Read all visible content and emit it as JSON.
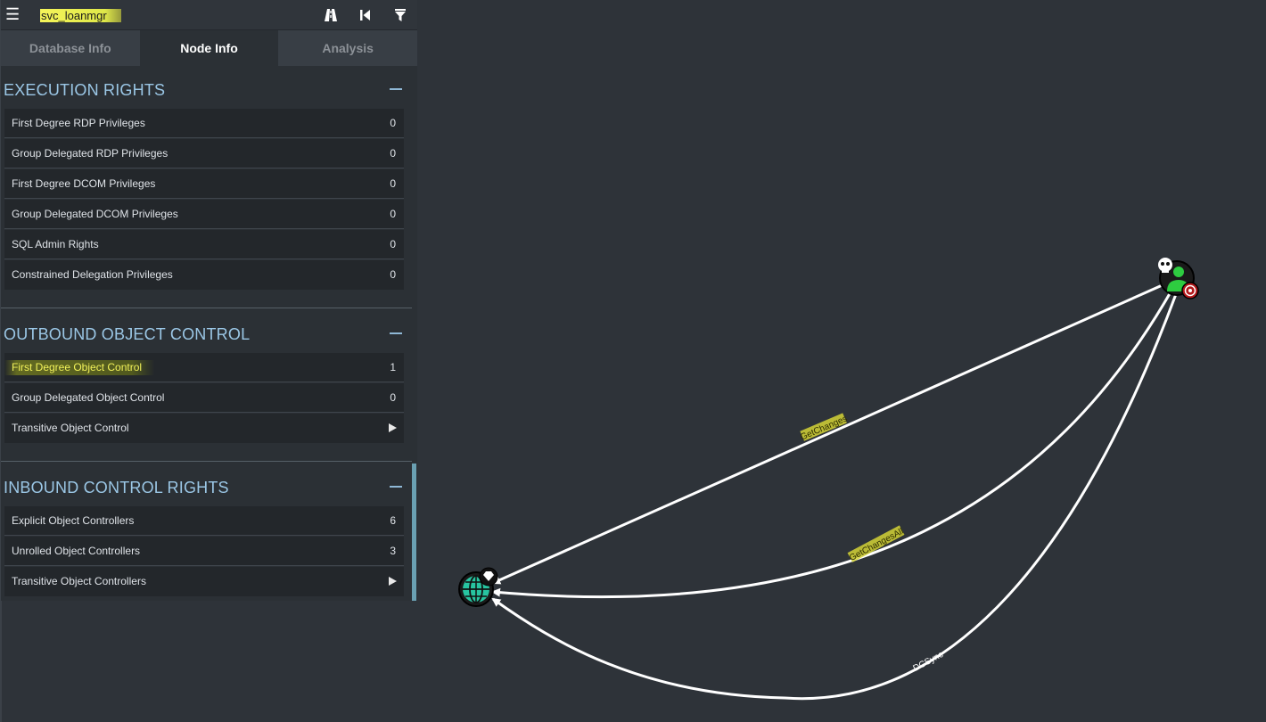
{
  "search": {
    "value": "svc_loanmgr"
  },
  "toolbar": {
    "pathfinding_icon": "road-icon",
    "back_icon": "skip-back-icon",
    "filter_icon": "filter-icon"
  },
  "tabs": [
    {
      "label": "Database Info",
      "active": false
    },
    {
      "label": "Node Info",
      "active": true
    },
    {
      "label": "Analysis",
      "active": false
    }
  ],
  "sections": {
    "execution": {
      "title": "EXECUTION RIGHTS",
      "rows": [
        {
          "label": "First Degree RDP Privileges",
          "value": "0"
        },
        {
          "label": "Group Delegated RDP Privileges",
          "value": "0"
        },
        {
          "label": "First Degree DCOM Privileges",
          "value": "0"
        },
        {
          "label": "Group Delegated DCOM Privileges",
          "value": "0"
        },
        {
          "label": "SQL Admin Rights",
          "value": "0"
        },
        {
          "label": "Constrained Delegation Privileges",
          "value": "0"
        }
      ]
    },
    "outbound": {
      "title": "OUTBOUND OBJECT CONTROL",
      "rows": [
        {
          "label": "First Degree Object Control",
          "value": "1"
        },
        {
          "label": "Group Delegated Object Control",
          "value": "0"
        },
        {
          "label": "Transitive Object Control",
          "value": ""
        }
      ]
    },
    "inbound": {
      "title": "INBOUND CONTROL RIGHTS",
      "rows": [
        {
          "label": "Explicit Object Controllers",
          "value": "6"
        },
        {
          "label": "Unrolled Object Controllers",
          "value": "3"
        },
        {
          "label": "Transitive Object Controllers",
          "value": ""
        }
      ]
    }
  },
  "graph": {
    "edges": [
      {
        "label": "GetChanges"
      },
      {
        "label": "GetChangesAll"
      },
      {
        "label": "DCSync"
      }
    ],
    "nodes": [
      {
        "kind": "user",
        "icon": "user-icon",
        "badges": [
          "skull-icon",
          "target-icon"
        ]
      },
      {
        "kind": "domain",
        "icon": "globe-icon",
        "badges": [
          "diamond-icon"
        ]
      }
    ]
  },
  "colors": {
    "background": "#2e3339",
    "panel": "#2b3035",
    "section_title": "#9bc7e6",
    "highlight": "#f2f25a",
    "edge": "#ffffff",
    "owned_user": "#2ecc40",
    "domain_node": "#27c4a0",
    "target_badge": "#cc1f1f"
  }
}
